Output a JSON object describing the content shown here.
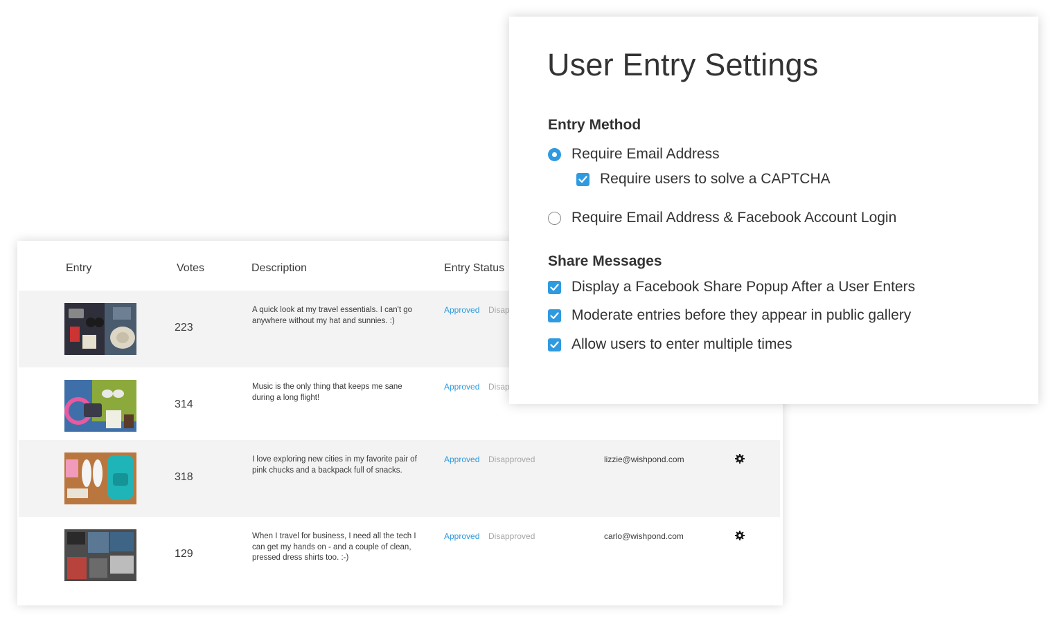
{
  "table": {
    "headers": {
      "entry": "Entry",
      "votes": "Votes",
      "description": "Description",
      "status": "Entry Status"
    },
    "rows": [
      {
        "votes": "223",
        "description": "A quick look at my travel essentials. I can't go anywhere without my hat and sunnies. :)",
        "approved": "Approved",
        "disapproved": "Disapp",
        "email": "",
        "photo": "travel-essentials-photo"
      },
      {
        "votes": "314",
        "description": "Music is the only thing that keeps me sane during a long flight!",
        "approved": "Approved",
        "disapproved": "Disap",
        "email": "",
        "photo": "headphones-photo"
      },
      {
        "votes": "318",
        "description": "I love exploring new cities in my favorite pair of pink chucks and a backpack full of snacks.",
        "approved": "Approved",
        "disapproved": "Disapproved",
        "email": "lizzie@wishpond.com",
        "photo": "backpack-photo"
      },
      {
        "votes": "129",
        "description": "When I travel for business, I need all the tech I can get my hands on - and a couple of clean, pressed dress shirts too. :-)",
        "approved": "Approved",
        "disapproved": "Disapproved",
        "email": "carlo@wishpond.com",
        "photo": "business-travel-photo"
      }
    ]
  },
  "settings": {
    "title": "User Entry Settings",
    "entry_method": {
      "heading": "Entry Method",
      "option_email": "Require Email Address",
      "option_captcha": "Require users to solve a CAPTCHA",
      "option_facebook": "Require Email Address & Facebook Account Login",
      "selected": "Require Email Address",
      "captcha_checked": true
    },
    "share_messages": {
      "heading": "Share Messages",
      "options": [
        {
          "label": "Display a Facebook Share Popup After a User Enters",
          "checked": true
        },
        {
          "label": "Moderate entries before they appear in public gallery",
          "checked": true
        },
        {
          "label": "Allow users to enter multiple times",
          "checked": true
        }
      ]
    }
  },
  "colors": {
    "accent": "#2f9ae0",
    "row_shade": "#f3f3f3",
    "muted": "#a6a6a6"
  }
}
